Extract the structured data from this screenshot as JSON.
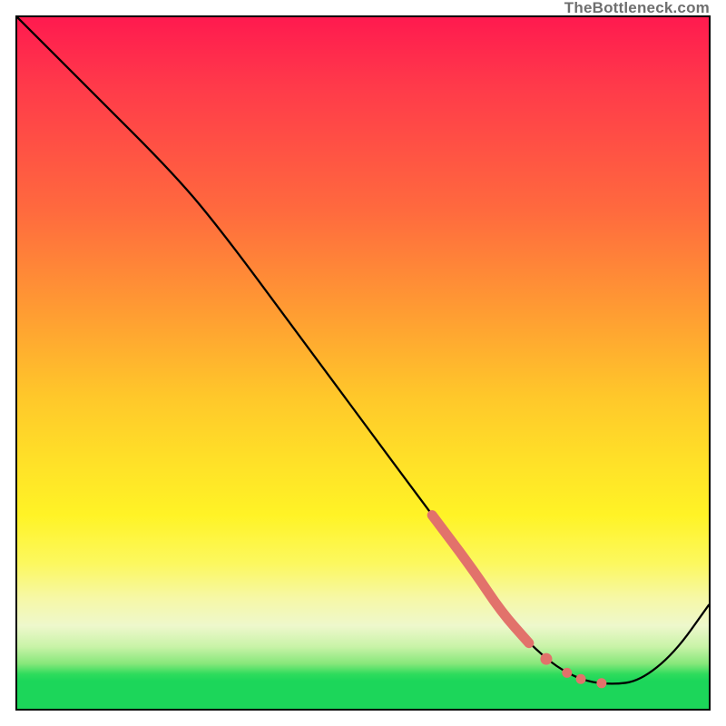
{
  "watermark": "TheBottleneck.com",
  "chart_data": {
    "type": "line",
    "title": "",
    "xlabel": "",
    "ylabel": "",
    "xlim": [
      0,
      100
    ],
    "ylim": [
      0,
      100
    ],
    "grid": false,
    "series": [
      {
        "name": "bottleneck-curve",
        "x": [
          0,
          10,
          23,
          30,
          40,
          50,
          60,
          66,
          70,
          74,
          78,
          82,
          86,
          90,
          95,
          100
        ],
        "y": [
          100,
          90,
          77,
          68.5,
          55,
          41.5,
          28,
          20,
          14,
          9.5,
          6,
          4,
          3.5,
          4,
          8,
          15
        ]
      }
    ],
    "highlight_segment": {
      "name": "highlighted-range",
      "color": "#e2726b",
      "x": [
        60,
        66,
        70,
        74
      ],
      "y": [
        28,
        20,
        14,
        9.5
      ]
    },
    "highlight_points": {
      "name": "highlight-dots",
      "color": "#e2726b",
      "points": [
        {
          "x": 76.5,
          "y": 7.2
        },
        {
          "x": 79.5,
          "y": 5.2
        },
        {
          "x": 81.5,
          "y": 4.3
        },
        {
          "x": 84.5,
          "y": 3.7
        }
      ]
    }
  }
}
